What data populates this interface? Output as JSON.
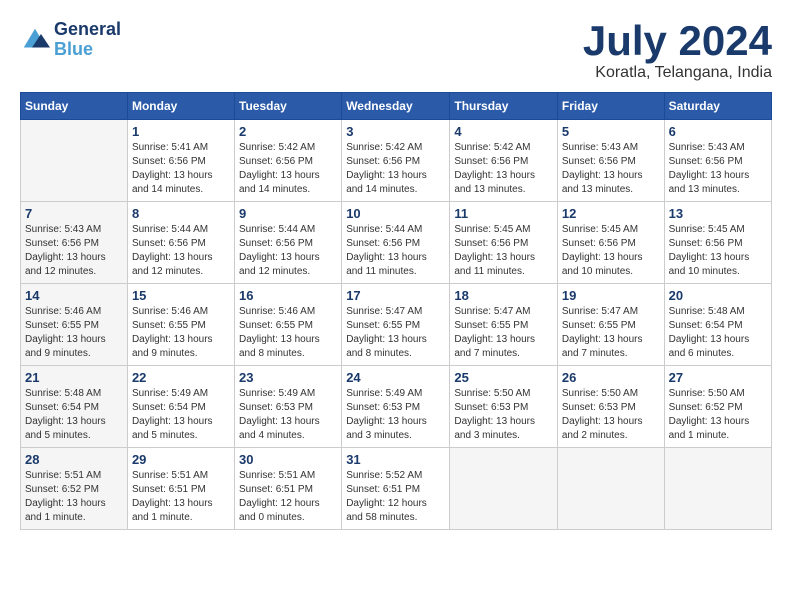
{
  "header": {
    "logo_line1": "General",
    "logo_line2": "Blue",
    "month_title": "July 2024",
    "location": "Koratla, Telangana, India"
  },
  "weekdays": [
    "Sunday",
    "Monday",
    "Tuesday",
    "Wednesday",
    "Thursday",
    "Friday",
    "Saturday"
  ],
  "weeks": [
    [
      {
        "day": "",
        "info": ""
      },
      {
        "day": "1",
        "info": "Sunrise: 5:41 AM\nSunset: 6:56 PM\nDaylight: 13 hours\nand 14 minutes."
      },
      {
        "day": "2",
        "info": "Sunrise: 5:42 AM\nSunset: 6:56 PM\nDaylight: 13 hours\nand 14 minutes."
      },
      {
        "day": "3",
        "info": "Sunrise: 5:42 AM\nSunset: 6:56 PM\nDaylight: 13 hours\nand 14 minutes."
      },
      {
        "day": "4",
        "info": "Sunrise: 5:42 AM\nSunset: 6:56 PM\nDaylight: 13 hours\nand 13 minutes."
      },
      {
        "day": "5",
        "info": "Sunrise: 5:43 AM\nSunset: 6:56 PM\nDaylight: 13 hours\nand 13 minutes."
      },
      {
        "day": "6",
        "info": "Sunrise: 5:43 AM\nSunset: 6:56 PM\nDaylight: 13 hours\nand 13 minutes."
      }
    ],
    [
      {
        "day": "7",
        "info": "Sunrise: 5:43 AM\nSunset: 6:56 PM\nDaylight: 13 hours\nand 12 minutes."
      },
      {
        "day": "8",
        "info": "Sunrise: 5:44 AM\nSunset: 6:56 PM\nDaylight: 13 hours\nand 12 minutes."
      },
      {
        "day": "9",
        "info": "Sunrise: 5:44 AM\nSunset: 6:56 PM\nDaylight: 13 hours\nand 12 minutes."
      },
      {
        "day": "10",
        "info": "Sunrise: 5:44 AM\nSunset: 6:56 PM\nDaylight: 13 hours\nand 11 minutes."
      },
      {
        "day": "11",
        "info": "Sunrise: 5:45 AM\nSunset: 6:56 PM\nDaylight: 13 hours\nand 11 minutes."
      },
      {
        "day": "12",
        "info": "Sunrise: 5:45 AM\nSunset: 6:56 PM\nDaylight: 13 hours\nand 10 minutes."
      },
      {
        "day": "13",
        "info": "Sunrise: 5:45 AM\nSunset: 6:56 PM\nDaylight: 13 hours\nand 10 minutes."
      }
    ],
    [
      {
        "day": "14",
        "info": "Sunrise: 5:46 AM\nSunset: 6:55 PM\nDaylight: 13 hours\nand 9 minutes."
      },
      {
        "day": "15",
        "info": "Sunrise: 5:46 AM\nSunset: 6:55 PM\nDaylight: 13 hours\nand 9 minutes."
      },
      {
        "day": "16",
        "info": "Sunrise: 5:46 AM\nSunset: 6:55 PM\nDaylight: 13 hours\nand 8 minutes."
      },
      {
        "day": "17",
        "info": "Sunrise: 5:47 AM\nSunset: 6:55 PM\nDaylight: 13 hours\nand 8 minutes."
      },
      {
        "day": "18",
        "info": "Sunrise: 5:47 AM\nSunset: 6:55 PM\nDaylight: 13 hours\nand 7 minutes."
      },
      {
        "day": "19",
        "info": "Sunrise: 5:47 AM\nSunset: 6:55 PM\nDaylight: 13 hours\nand 7 minutes."
      },
      {
        "day": "20",
        "info": "Sunrise: 5:48 AM\nSunset: 6:54 PM\nDaylight: 13 hours\nand 6 minutes."
      }
    ],
    [
      {
        "day": "21",
        "info": "Sunrise: 5:48 AM\nSunset: 6:54 PM\nDaylight: 13 hours\nand 5 minutes."
      },
      {
        "day": "22",
        "info": "Sunrise: 5:49 AM\nSunset: 6:54 PM\nDaylight: 13 hours\nand 5 minutes."
      },
      {
        "day": "23",
        "info": "Sunrise: 5:49 AM\nSunset: 6:53 PM\nDaylight: 13 hours\nand 4 minutes."
      },
      {
        "day": "24",
        "info": "Sunrise: 5:49 AM\nSunset: 6:53 PM\nDaylight: 13 hours\nand 3 minutes."
      },
      {
        "day": "25",
        "info": "Sunrise: 5:50 AM\nSunset: 6:53 PM\nDaylight: 13 hours\nand 3 minutes."
      },
      {
        "day": "26",
        "info": "Sunrise: 5:50 AM\nSunset: 6:53 PM\nDaylight: 13 hours\nand 2 minutes."
      },
      {
        "day": "27",
        "info": "Sunrise: 5:50 AM\nSunset: 6:52 PM\nDaylight: 13 hours\nand 1 minute."
      }
    ],
    [
      {
        "day": "28",
        "info": "Sunrise: 5:51 AM\nSunset: 6:52 PM\nDaylight: 13 hours\nand 1 minute."
      },
      {
        "day": "29",
        "info": "Sunrise: 5:51 AM\nSunset: 6:51 PM\nDaylight: 13 hours\nand 1 minute."
      },
      {
        "day": "30",
        "info": "Sunrise: 5:51 AM\nSunset: 6:51 PM\nDaylight: 12 hours\nand 0 minutes."
      },
      {
        "day": "31",
        "info": "Sunrise: 5:52 AM\nSunset: 6:51 PM\nDaylight: 12 hours\nand 58 minutes."
      },
      {
        "day": "",
        "info": ""
      },
      {
        "day": "",
        "info": ""
      },
      {
        "day": "",
        "info": ""
      }
    ]
  ]
}
